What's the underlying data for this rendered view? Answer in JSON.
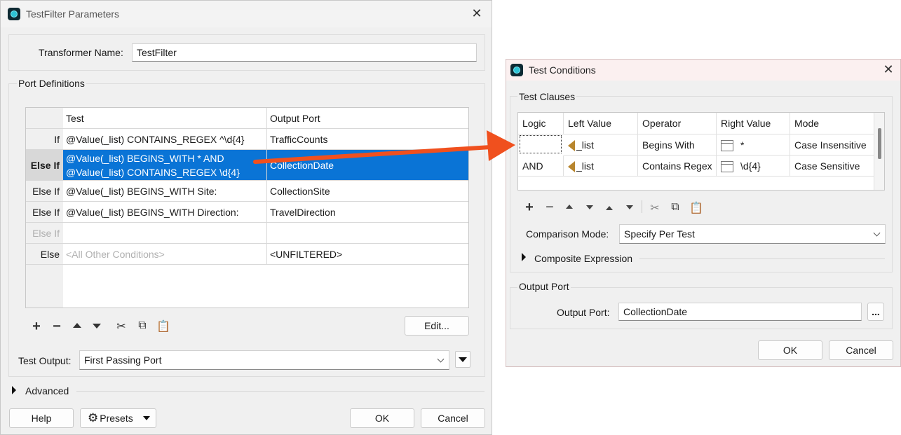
{
  "main_dialog": {
    "title": "TestFilter Parameters",
    "transformer_name_label": "Transformer Name:",
    "transformer_name_value": "TestFilter",
    "port_definitions_label": "Port Definitions",
    "table": {
      "headers": [
        "",
        "Test",
        "Output Port"
      ],
      "rows": [
        {
          "kind": "If",
          "test": "@Value(_list) CONTAINS_REGEX ^\\d{4}",
          "test2": "",
          "port": "TrafficCounts"
        },
        {
          "kind": "Else If",
          "test": "@Value(_list) BEGINS_WITH * AND",
          "test2": "@Value(_list) CONTAINS_REGEX \\d{4}",
          "port": "CollectionDate"
        },
        {
          "kind": "Else If",
          "test": "@Value(_list) BEGINS_WITH Site:",
          "test2": "",
          "port": "CollectionSite"
        },
        {
          "kind": "Else If",
          "test": "@Value(_list) BEGINS_WITH Direction:",
          "test2": "",
          "port": "TravelDirection"
        },
        {
          "kind": "Else If",
          "test": "",
          "test2": "",
          "port": ""
        },
        {
          "kind": "Else",
          "test": "<All Other Conditions>",
          "test2": "",
          "port": "<UNFILTERED>"
        }
      ]
    },
    "edit_button": "Edit...",
    "test_output_label": "Test Output:",
    "test_output_value": "First Passing Port",
    "advanced_label": "Advanced",
    "help_button": "Help",
    "presets_button": "Presets",
    "ok_button": "OK",
    "cancel_button": "Cancel"
  },
  "conditions_dialog": {
    "title": "Test Conditions",
    "test_clauses_label": "Test Clauses",
    "headers": [
      "Logic",
      "Left Value",
      "Operator",
      "Right Value",
      "Mode"
    ],
    "rows": [
      {
        "logic": "",
        "left": "_list",
        "operator": "Begins With",
        "right": "*",
        "mode": "Case Insensitive"
      },
      {
        "logic": "AND",
        "left": "_list",
        "operator": "Contains Regex",
        "right": "\\d{4}",
        "mode": "Case Sensitive"
      }
    ],
    "comparison_mode_label": "Comparison Mode:",
    "comparison_mode_value": "Specify Per Test",
    "composite_expression_label": "Composite Expression",
    "output_port_group_label": "Output Port",
    "output_port_label": "Output Port:",
    "output_port_value": "CollectionDate",
    "browse_button": "...",
    "ok_button": "OK",
    "cancel_button": "Cancel"
  },
  "colors": {
    "selection": "#0a74d6",
    "annotation_arrow": "#f0501e"
  }
}
